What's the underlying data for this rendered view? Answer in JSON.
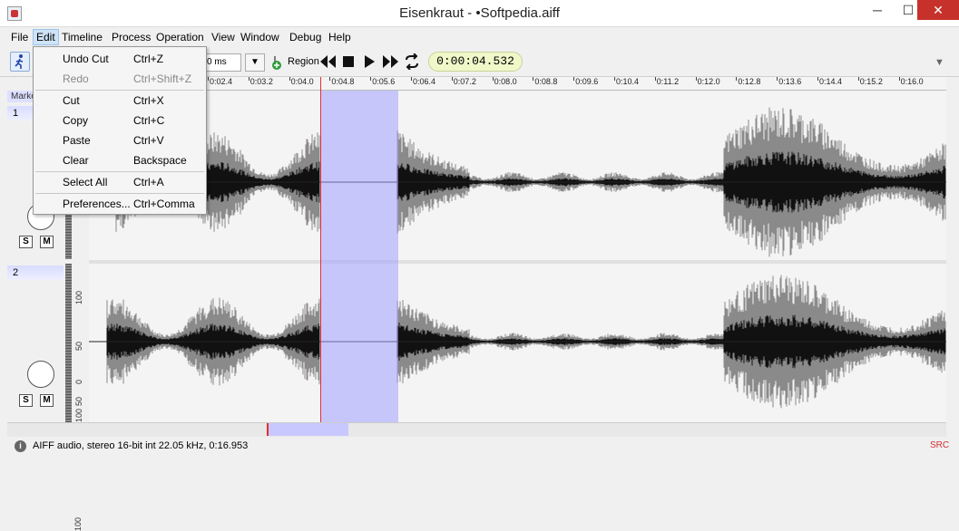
{
  "window": {
    "title": "Eisenkraut - •Softpedia.aiff",
    "minimize": "─",
    "maximize": "☐",
    "close": "✕"
  },
  "menubar": [
    "File",
    "Edit",
    "Timeline",
    "Process",
    "Operation",
    "View",
    "Window",
    "Debug",
    "Help"
  ],
  "toolbar": {
    "ms_value": "0 ms",
    "region_label": "Region",
    "timecode": "0:00:04.532"
  },
  "timeline_ticks": [
    "0:02.4",
    "0:03.2",
    "0:04.0",
    "0:04.8",
    "0:05.6",
    "0:06.4",
    "0:07.2",
    "0:08.0",
    "0:08.8",
    "0:09.6",
    "0:10.4",
    "0:11.2",
    "0:12.0",
    "0:12.8",
    "0:13.6",
    "0:14.4",
    "0:15.2",
    "0:16.0"
  ],
  "marker_label": "Markers",
  "tracks": [
    {
      "label": "1",
      "solo": "S",
      "mute": "M"
    },
    {
      "label": "2",
      "solo": "S",
      "mute": "M"
    }
  ],
  "yaxis_labels": {
    "track1": [
      "100"
    ],
    "track2": [
      "100",
      "50",
      "0",
      "50",
      "100"
    ]
  },
  "edit_menu": [
    {
      "label": "Undo Cut",
      "shortcut": "Ctrl+Z",
      "enabled": true
    },
    {
      "label": "Redo",
      "shortcut": "Ctrl+Shift+Z",
      "enabled": false
    },
    {
      "label": "Cut",
      "shortcut": "Ctrl+X",
      "enabled": true
    },
    {
      "label": "Copy",
      "shortcut": "Ctrl+C",
      "enabled": true
    },
    {
      "label": "Paste",
      "shortcut": "Ctrl+V",
      "enabled": true
    },
    {
      "label": "Clear",
      "shortcut": "Backspace",
      "enabled": true
    },
    {
      "label": "Select All",
      "shortcut": "Ctrl+A",
      "enabled": true
    },
    {
      "label": "Preferences...",
      "shortcut": "Ctrl+Comma",
      "enabled": true
    }
  ],
  "status": {
    "text": "AIFF audio, stereo 16-bit int 22.05 kHz, 0:16.953",
    "src": "SRC"
  },
  "colors": {
    "selection": "#a0a0ff",
    "cursor": "#e23030",
    "timecode_bg": "#f0f7c8",
    "close_button": "#c7312b"
  }
}
